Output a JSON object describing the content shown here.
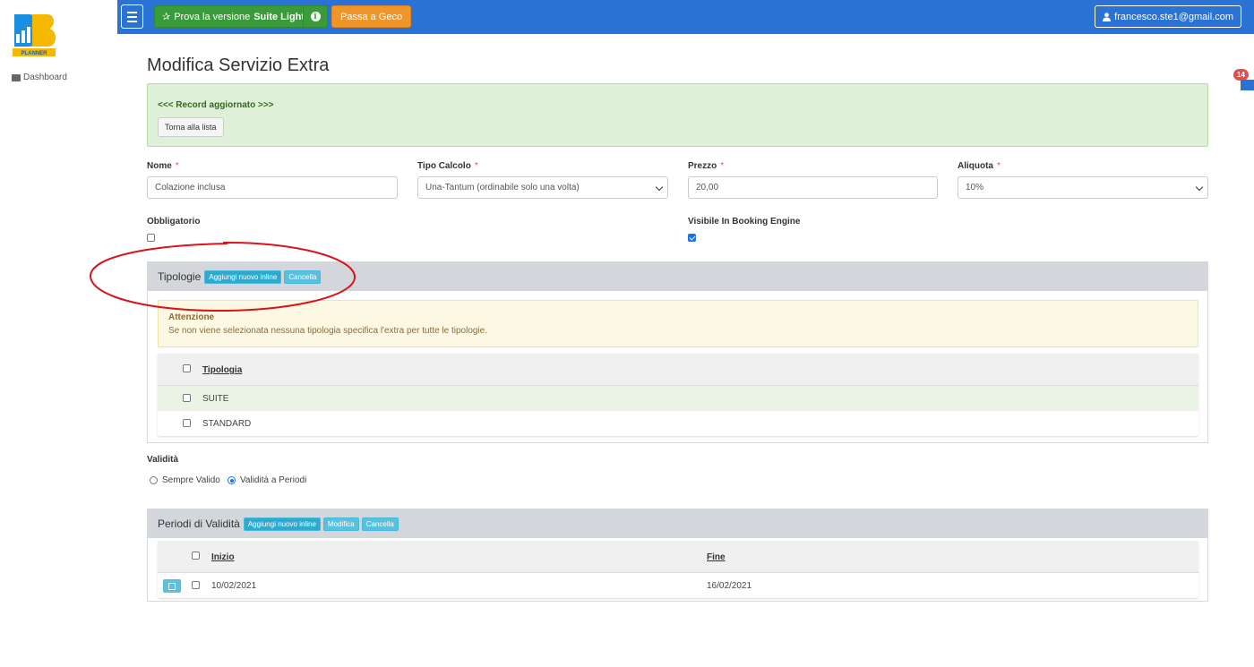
{
  "topbar": {
    "trial_prefix": "Prova la versione",
    "trial_bold": "Suite Light",
    "geco_label": "Passa a Geco",
    "user_email": "francesco.ste1@gmail.com"
  },
  "sidebar": {
    "logo_text": "PLANNER",
    "dashboard_label": "Dashboard"
  },
  "notifications": {
    "count": "14"
  },
  "page": {
    "title": "Modifica Servizio Extra"
  },
  "alert": {
    "message": "<<< Record aggiornato >>>",
    "back_label": "Torna alla lista"
  },
  "form": {
    "nome": {
      "label": "Nome",
      "value": "Colazione inclusa"
    },
    "tipo_calcolo": {
      "label": "Tipo Calcolo",
      "value": "Una-Tantum (ordinabile solo una volta)"
    },
    "prezzo": {
      "label": "Prezzo",
      "value": "20,00"
    },
    "aliquota": {
      "label": "Aliquota",
      "value": "10%"
    },
    "obbligatorio": {
      "label": "Obbligatorio",
      "checked": false
    },
    "visibile": {
      "label": "Visibile In Booking Engine",
      "checked": true
    },
    "required_mark": "*"
  },
  "tipologie": {
    "title": "Tipologie",
    "add_label": "Aggiungi nuovo inline",
    "cancel_label": "Cancella",
    "warning_title": "Attenzione",
    "warning_body": "Se non viene selezionata nessuna tipologia specifica l'extra per tutte le tipologie.",
    "column": "Tipologia",
    "rows": [
      {
        "name": "SUITE",
        "highlighted": true
      },
      {
        "name": "STANDARD",
        "highlighted": false
      }
    ]
  },
  "validita": {
    "label": "Validità",
    "option_always": "Sempre Valido",
    "option_periods": "Validità a Periodi",
    "selected": "periods"
  },
  "periodi": {
    "title": "Periodi di Validità",
    "add_label": "Aggiungi nuovo inline",
    "edit_label": "Modifica",
    "cancel_label": "Cancella",
    "col_start": "Inizio",
    "col_end": "Fine",
    "rows": [
      {
        "start": "10/02/2021",
        "end": "16/02/2021"
      }
    ]
  },
  "colors": {
    "topbar": "#2a72d4",
    "green": "#3a9b3a",
    "orange": "#f0952a",
    "info_blue": "#5bc0de",
    "annotation_red": "#d9131a"
  }
}
